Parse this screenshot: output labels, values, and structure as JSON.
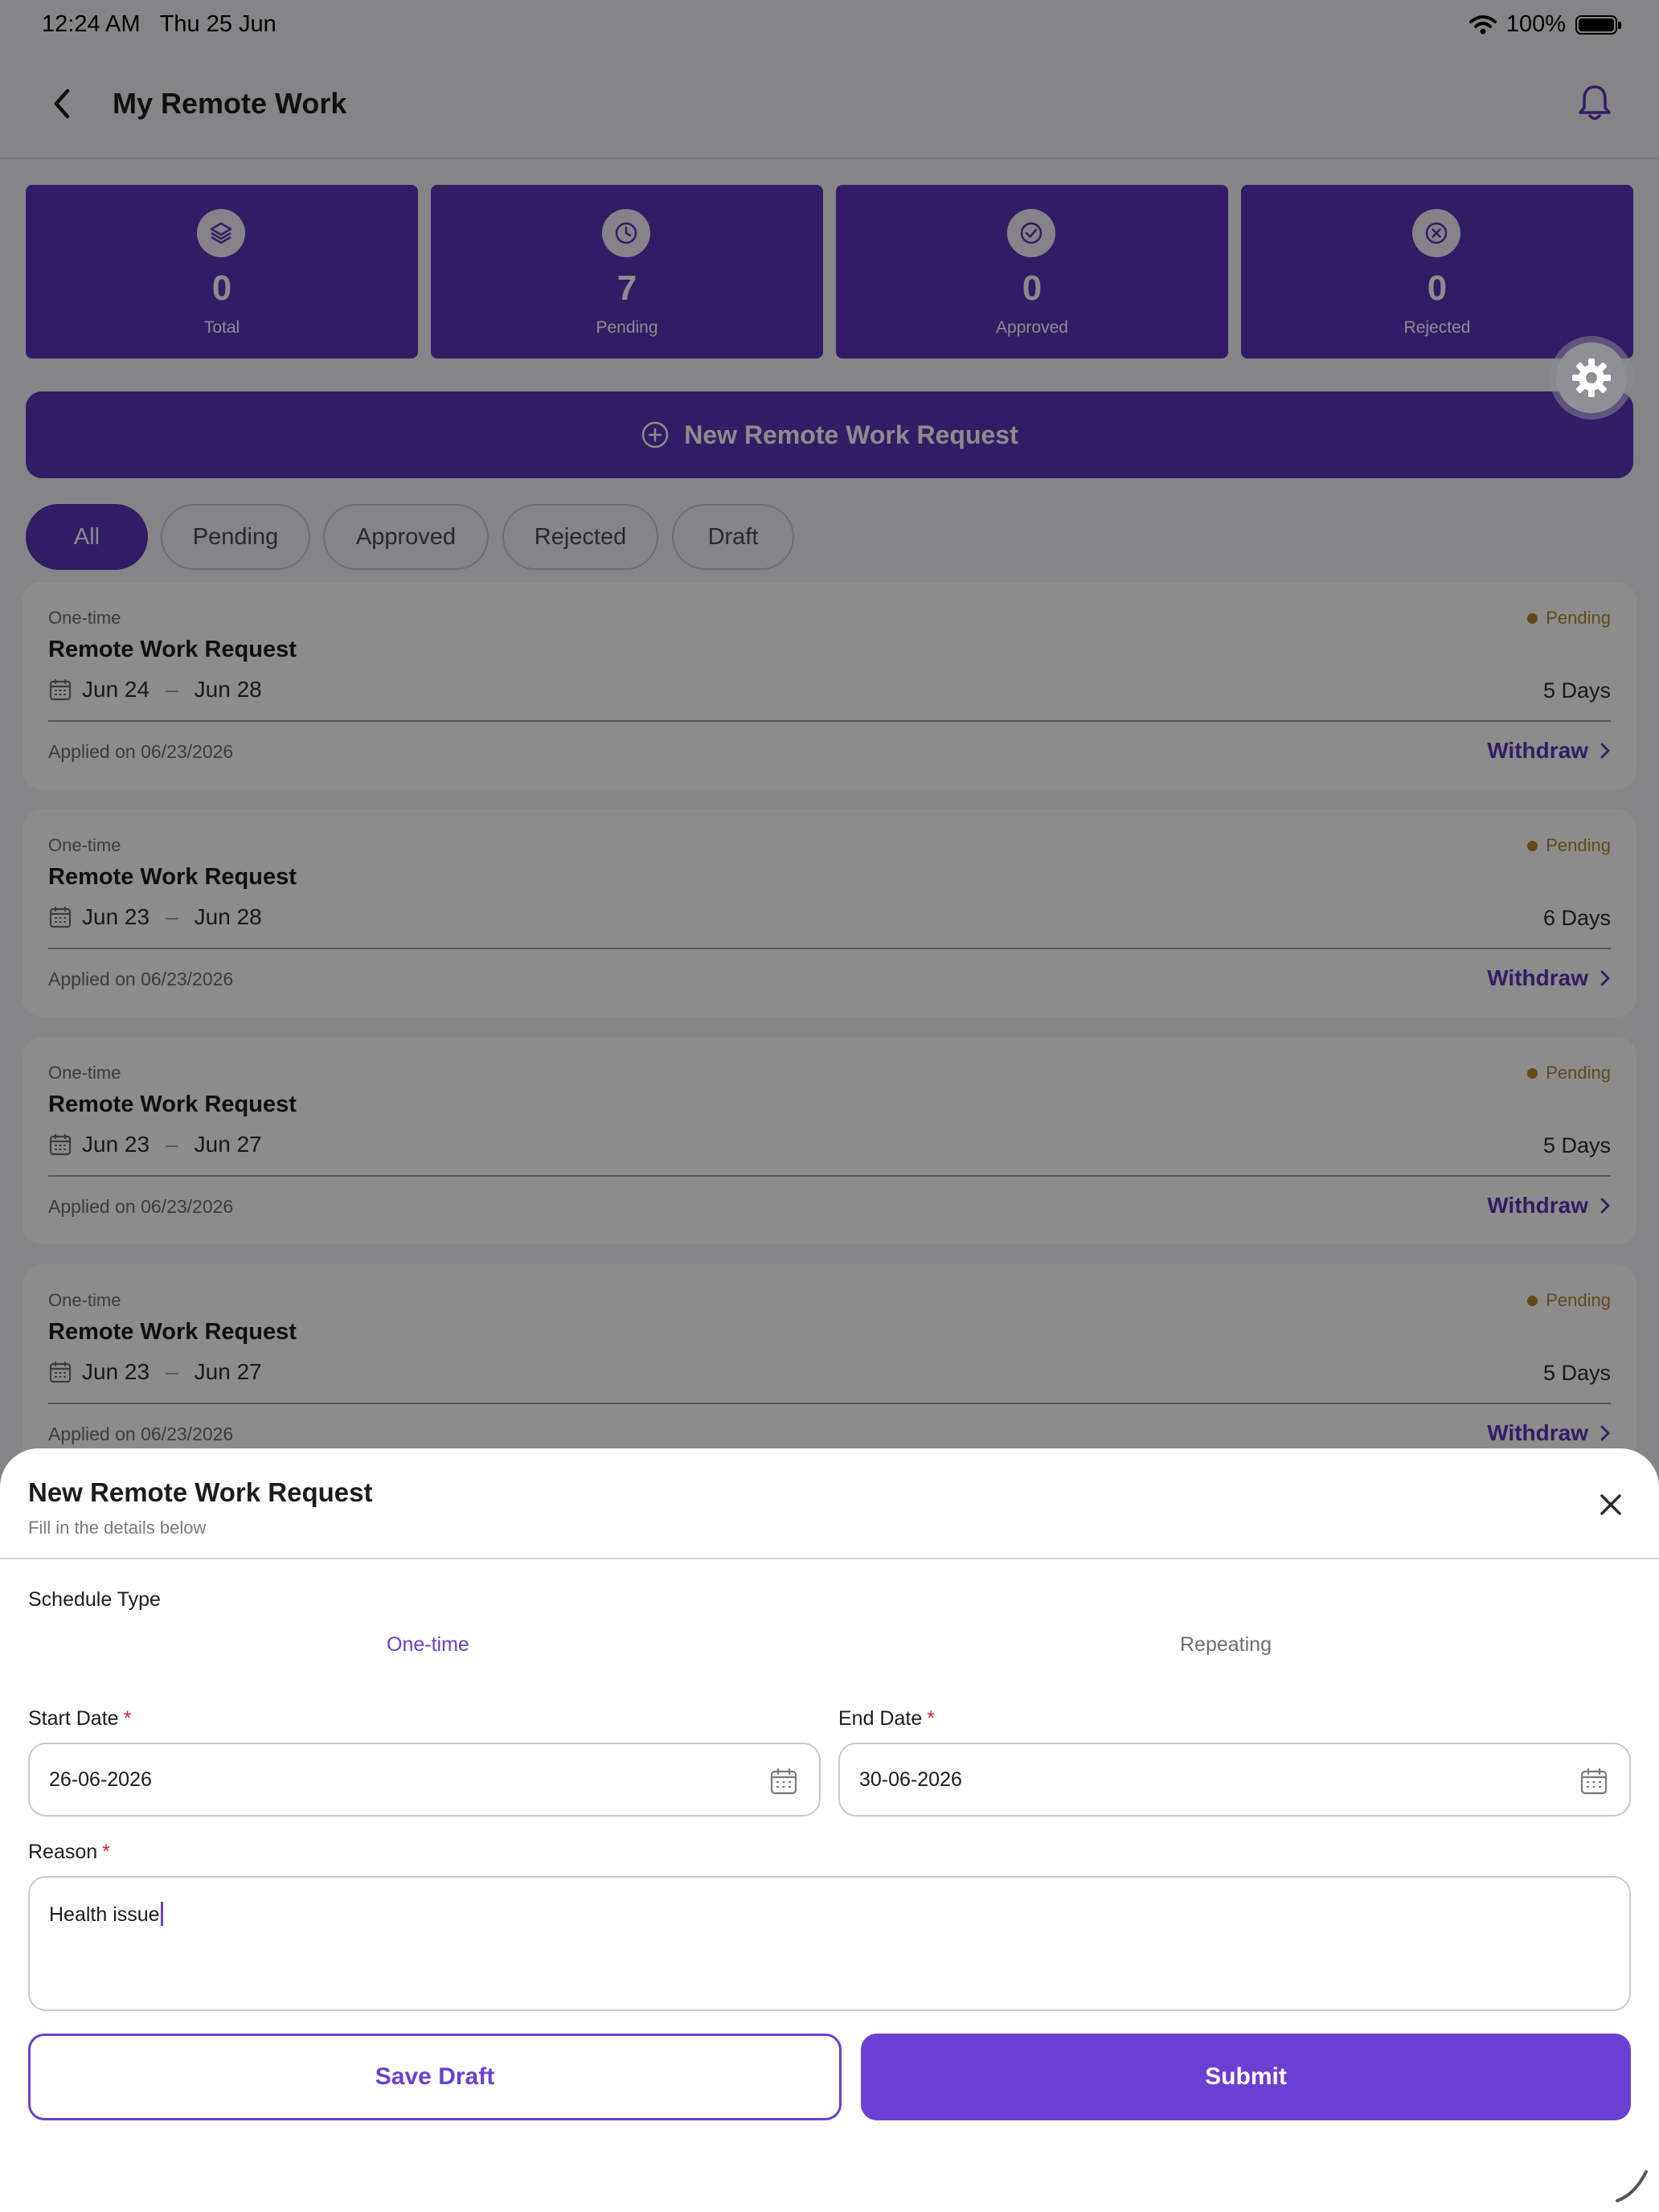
{
  "status_bar": {
    "time": "12:24 AM",
    "date": "Thu 25 Jun",
    "battery": "100%"
  },
  "header": {
    "title": "My Remote Work"
  },
  "stats": [
    {
      "value": "0",
      "label": "Total",
      "icon": "layers-icon"
    },
    {
      "value": "7",
      "label": "Pending",
      "icon": "clock-icon"
    },
    {
      "value": "0",
      "label": "Approved",
      "icon": "check-circle-icon"
    },
    {
      "value": "0",
      "label": "Rejected",
      "icon": "x-circle-icon"
    }
  ],
  "new_request_button": "New Remote Work Request",
  "filters": [
    "All",
    "Pending",
    "Approved",
    "Rejected",
    "Draft"
  ],
  "active_filter": "All",
  "requests": [
    {
      "type": "One-time",
      "title": "Remote Work Request",
      "status": "Pending",
      "start": "Jun 24",
      "end": "Jun 28",
      "days": "5 Days",
      "applied": "Applied on 06/23/2026",
      "action": "Withdraw"
    },
    {
      "type": "One-time",
      "title": "Remote Work Request",
      "status": "Pending",
      "start": "Jun 23",
      "end": "Jun 28",
      "days": "6 Days",
      "applied": "Applied on 06/23/2026",
      "action": "Withdraw"
    },
    {
      "type": "One-time",
      "title": "Remote Work Request",
      "status": "Pending",
      "start": "Jun 23",
      "end": "Jun 27",
      "days": "5 Days",
      "applied": "Applied on 06/23/2026",
      "action": "Withdraw"
    },
    {
      "type": "One-time",
      "title": "Remote Work Request",
      "status": "Pending",
      "start": "Jun 23",
      "end": "Jun 27",
      "days": "5 Days",
      "applied": "Applied on 06/23/2026",
      "action": "Withdraw"
    }
  ],
  "sheet": {
    "title": "New Remote Work Request",
    "subtitle": "Fill in the details below",
    "schedule_label": "Schedule Type",
    "schedule_options": [
      "One-time",
      "Repeating"
    ],
    "schedule_selected": "One-time",
    "start_label": "Start Date",
    "start_value": "26-06-2026",
    "end_label": "End Date",
    "end_value": "30-06-2026",
    "required_mark": "*",
    "reason_label": "Reason",
    "reason_value": "Health issue",
    "save_draft": "Save Draft",
    "submit": "Submit"
  },
  "colors": {
    "accent": "#5b33b8",
    "sheet_accent": "#6a3fd1",
    "pending": "#b5852c"
  }
}
